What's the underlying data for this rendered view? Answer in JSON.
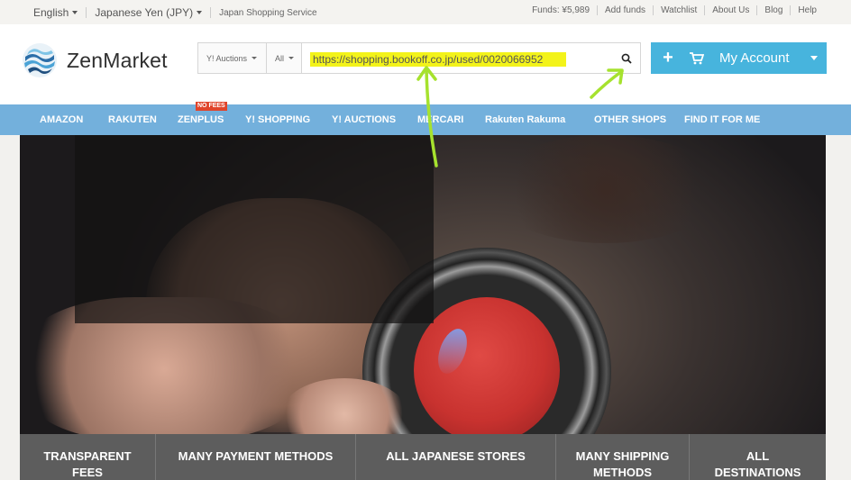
{
  "topbar": {
    "language": "English",
    "currency": "Japanese Yen (JPY)",
    "service": "Japan Shopping Service",
    "links": [
      "Funds: ¥5,989",
      "Add funds",
      "Watchlist",
      "About Us",
      "Blog",
      "Help"
    ]
  },
  "logo": {
    "text": "ZenMarket"
  },
  "search": {
    "category": "Y! Auctions",
    "filter": "All",
    "value": "https://shopping.bookoff.co.jp/used/0020066952"
  },
  "account": {
    "label": "My Account",
    "plus": "+"
  },
  "nav": {
    "items": [
      "AMAZON",
      "RAKUTEN",
      "ZENPLUS",
      "Y! SHOPPING",
      "Y! AUCTIONS",
      "MERCARI",
      "Rakuten Rakuma",
      "OTHER SHOPS",
      "FIND IT FOR ME"
    ],
    "badge": "NO FEES"
  },
  "features": [
    {
      "line1": "TRANSPARENT",
      "line2": "FEES"
    },
    {
      "line1": "MANY PAYMENT METHODS",
      "line2": ""
    },
    {
      "line1": "ALL JAPANESE STORES",
      "line2": ""
    },
    {
      "line1": "MANY SHIPPING",
      "line2": "METHODS"
    },
    {
      "line1": "ALL",
      "line2": "DESTINATIONS"
    }
  ],
  "colors": {
    "accent": "#47b4dd",
    "nav": "#73b0dc",
    "highlight": "#f3f31a",
    "annotation_arrow": "#a6e22e",
    "badge": "#e0442a"
  },
  "icons": [
    "logo-icon",
    "search-icon",
    "plus-icon",
    "cart-icon",
    "caret-down-icon",
    "arrow-icon"
  ]
}
